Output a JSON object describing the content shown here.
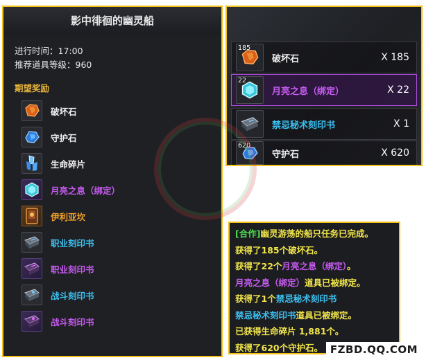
{
  "colors": {
    "border_accent": "#f2c21b",
    "panel_bg": "#1f2024",
    "header_gold": "#e8b63a",
    "white_item": "#f0f0f0",
    "purple_item": "#c65bf0",
    "orange_item": "#f0a02a",
    "blue_item": "#3cc0f0",
    "system_yellow": "#f2e64a",
    "party_green": "#4fe04f"
  },
  "left_panel": {
    "title": "影中徘徊的幽灵船",
    "time_row": "进行时间：17:00",
    "level_row": "推荐道具等级：960",
    "rewards_title": "期望奖励",
    "rewards": [
      {
        "name": "破坏石",
        "icon": "destruction-stone-icon",
        "grade": "normal"
      },
      {
        "name": "守护石",
        "icon": "guardian-stone-icon",
        "grade": "normal"
      },
      {
        "name": "生命碎片",
        "icon": "life-shard-icon",
        "grade": "normal"
      },
      {
        "name": "月亮之息（绑定）",
        "icon": "moon-breath-icon",
        "grade": "rare"
      },
      {
        "name": "伊利亚坎",
        "icon": "illiakan-card-icon",
        "grade": "legend"
      },
      {
        "name": "职业刻印书",
        "icon": "class-engraving-book-icon",
        "grade": "blue"
      },
      {
        "name": "职业刻印书",
        "icon": "class-engraving-book-rare-icon",
        "grade": "rare"
      },
      {
        "name": "战斗刻印书",
        "icon": "combat-engraving-book-icon",
        "grade": "blue"
      },
      {
        "name": "战斗刻印书",
        "icon": "combat-engraving-book-rare-icon",
        "grade": "rare"
      }
    ]
  },
  "loot": {
    "items": [
      {
        "name": "破坏石",
        "badge": "185",
        "count": "X 185",
        "icon": "destruction-stone-icon",
        "grade": "normal"
      },
      {
        "name": "月亮之息（绑定）",
        "badge": "22",
        "count": "X 22",
        "icon": "moon-breath-icon",
        "grade": "rare"
      },
      {
        "name": "禁忌秘术刻印书",
        "badge": "",
        "count": "X 1",
        "icon": "forbidden-engraving-book-icon",
        "grade": "blue"
      },
      {
        "name": "守护石",
        "badge": "620",
        "count": "X 620",
        "icon": "guardian-stone-icon",
        "grade": "normal"
      }
    ]
  },
  "chat_log": {
    "line1": {
      "tag": "[合作]",
      "quest": "幽灵游荡的船只",
      "rest": "任务已完成。"
    },
    "line2": {
      "pre": "获得了185个",
      "item": "破坏石",
      "post": "。"
    },
    "line3": {
      "pre": "获得了22个",
      "item": "月亮之息（绑定）",
      "post": "。"
    },
    "line4": {
      "item": "月亮之息（绑定）",
      "post": "道具已被绑定。"
    },
    "line5": {
      "pre": "获得了1个",
      "item": "禁忌秘术刻印书",
      "post": ""
    },
    "line6": {
      "item": "禁忌秘术刻印书",
      "post": "道具已被绑定。"
    },
    "line7": {
      "text": "已获得生命碎片 1,881个。"
    },
    "line8": {
      "pre": "获得了620个",
      "item": "守护石",
      "post": "。"
    }
  },
  "watermark": {
    "site": "FZBD.QQ.COM"
  }
}
